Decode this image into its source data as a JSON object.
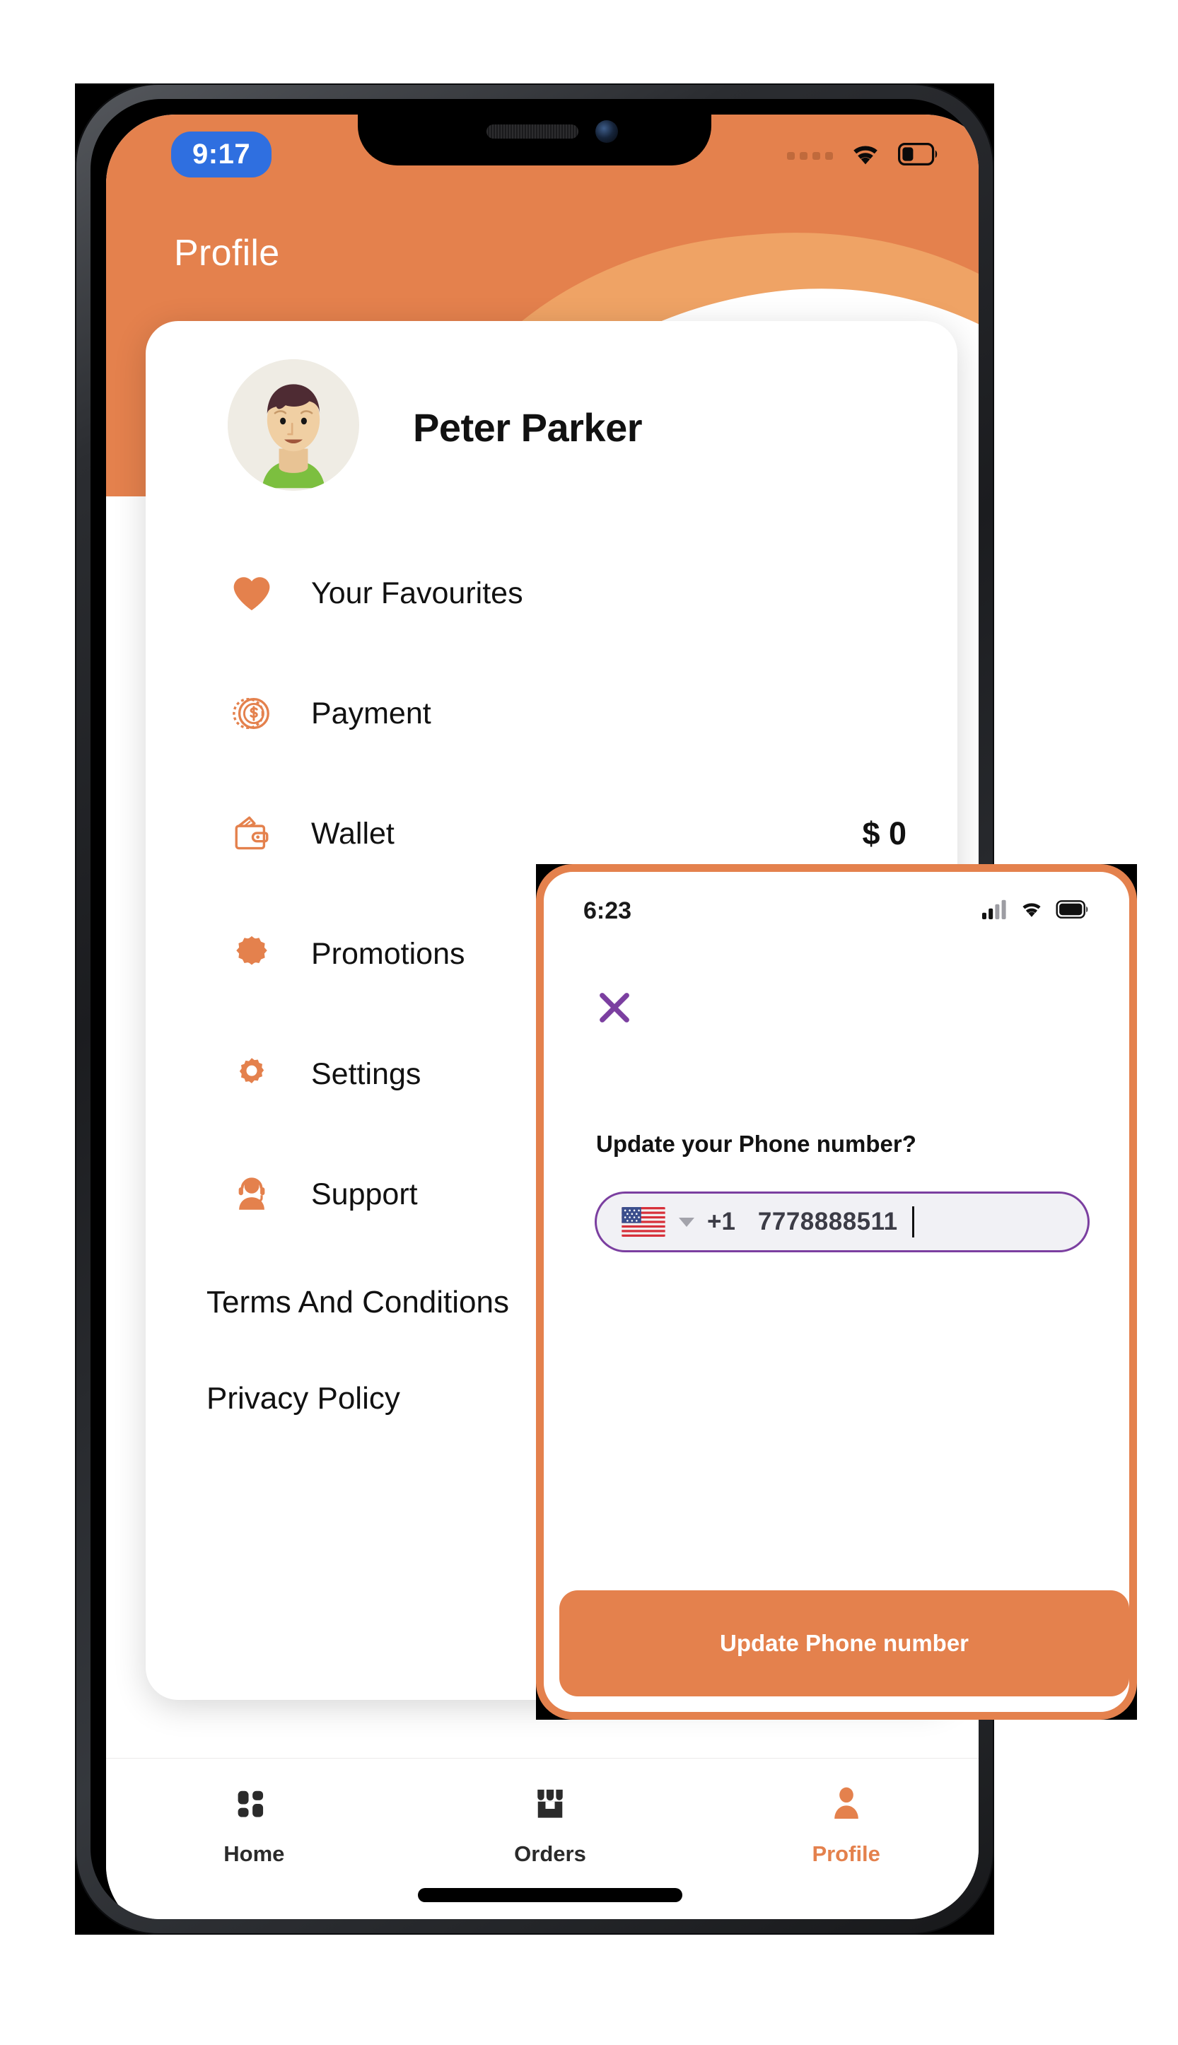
{
  "device": {
    "status_bar": {
      "time": "9:17",
      "icons": [
        "signal-dots-icon",
        "wifi-icon",
        "battery-icon"
      ]
    },
    "home_indicator": "home-indicator"
  },
  "header": {
    "title": "Profile",
    "background_color": "#e4814d",
    "wave_color": "#efa365"
  },
  "profile": {
    "name": "Peter Parker",
    "avatar": "user-avatar"
  },
  "menu": {
    "items": [
      {
        "icon": "heart-icon",
        "label": "Your Favourites",
        "value": ""
      },
      {
        "icon": "coin-icon",
        "label": "Payment",
        "value": ""
      },
      {
        "icon": "wallet-icon",
        "label": "Wallet",
        "value": "$ 0"
      },
      {
        "icon": "promotion-icon",
        "label": "Promotions",
        "value": ""
      },
      {
        "icon": "gear-icon",
        "label": "Settings",
        "value": ""
      },
      {
        "icon": "support-icon",
        "label": "Support",
        "value": ""
      }
    ],
    "links": [
      {
        "label": "Terms And Conditions"
      },
      {
        "label": "Privacy Policy"
      }
    ]
  },
  "tabbar": {
    "tabs": [
      {
        "icon": "grid-icon",
        "label": "Home",
        "active": false
      },
      {
        "icon": "store-icon",
        "label": "Orders",
        "active": false
      },
      {
        "icon": "person-icon",
        "label": "Profile",
        "active": true
      }
    ],
    "active_color": "#e4814d",
    "inactive_color": "#2b2b2b"
  },
  "modal": {
    "status_bar": {
      "time": "6:23",
      "icons": [
        "cellular-icon",
        "wifi-icon",
        "battery-icon"
      ]
    },
    "close_icon": "close-x-icon",
    "close_color": "#7b3fa0",
    "question": "Update your Phone number?",
    "phone_input": {
      "flag": "us-flag-icon",
      "dropdown_icon": "chevron-down-icon",
      "country_code": "+1",
      "value": "7778888511",
      "border_color": "#7b3fa0"
    },
    "submit_label": "Update Phone number",
    "submit_color": "#e4814d",
    "border_color": "#e4814d"
  }
}
